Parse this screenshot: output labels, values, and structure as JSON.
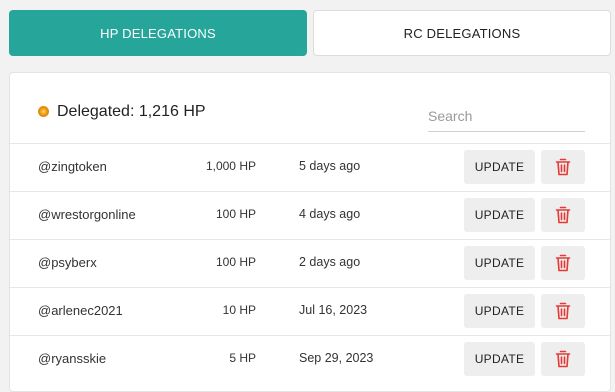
{
  "tabs": {
    "hp_label": "HP DELEGATIONS",
    "rc_label": "RC DELEGATIONS"
  },
  "panel": {
    "delegated_label": "Delegated: 1,216 HP",
    "search_placeholder": "Search",
    "update_label": "UPDATE",
    "coin_icon": "hp-coin-icon",
    "delete_icon": "trash-icon",
    "accent_color": "#26a69a",
    "delete_color": "#e53935"
  },
  "delegations": [
    {
      "account": "@zingtoken",
      "amount": "1,000 HP",
      "date": "5 days ago"
    },
    {
      "account": "@wrestorgonline",
      "amount": "100 HP",
      "date": "4 days ago"
    },
    {
      "account": "@psyberx",
      "amount": "100 HP",
      "date": "2 days ago"
    },
    {
      "account": "@arlenec2021",
      "amount": "10 HP",
      "date": "Jul 16, 2023"
    },
    {
      "account": "@ryansskie",
      "amount": "5 HP",
      "date": "Sep 29, 2023"
    }
  ]
}
